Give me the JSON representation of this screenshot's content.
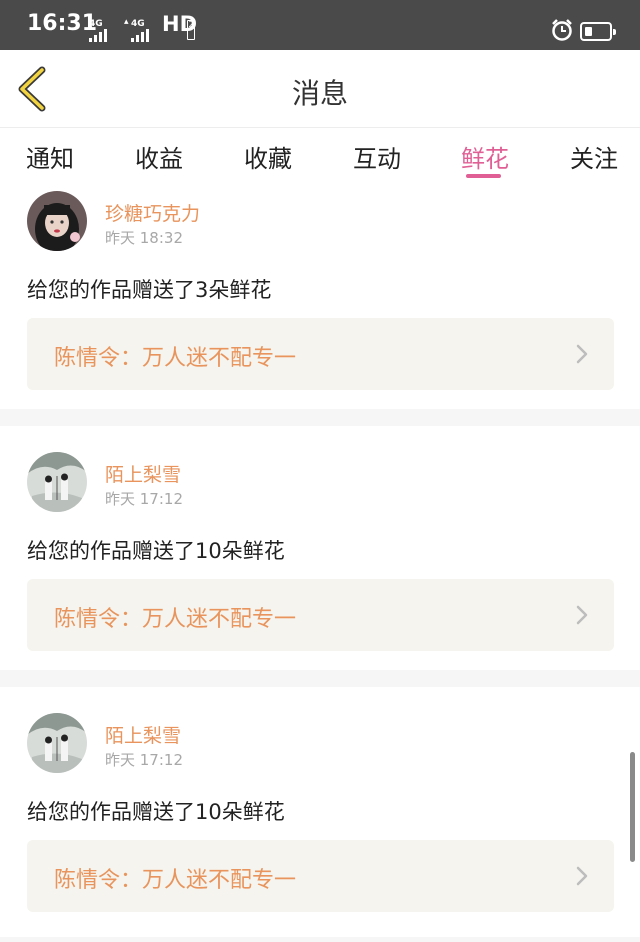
{
  "status_bar": {
    "time": "16:31",
    "network_1": "4G",
    "network_2": "4G",
    "hd_label": "HD",
    "hd_sub": "2"
  },
  "header": {
    "title": "消息"
  },
  "tabs": [
    {
      "label": "通知"
    },
    {
      "label": "收益"
    },
    {
      "label": "收藏"
    },
    {
      "label": "互动"
    },
    {
      "label": "鲜花",
      "active": true
    },
    {
      "label": "关注"
    }
  ],
  "messages": [
    {
      "user": "珍糖巧克力",
      "time": "昨天 18:32",
      "text": "给您的作品赠送了3朵鲜花",
      "work": "陈情令：万人迷不配专一",
      "avatar": "girl-photo"
    },
    {
      "user": "陌上梨雪",
      "time": "昨天 17:12",
      "text": "给您的作品赠送了10朵鲜花",
      "work": "陈情令：万人迷不配专一",
      "avatar": "ink-painting"
    },
    {
      "user": "陌上梨雪",
      "time": "昨天 17:12",
      "text": "给您的作品赠送了10朵鲜花",
      "work": "陈情令：万人迷不配专一",
      "avatar": "ink-painting"
    }
  ],
  "colors": {
    "accent_pink": "#e06096",
    "name_orange": "#e8945c",
    "link_bg": "#f5f4ee"
  },
  "icons": {
    "back": "chevron-left-icon",
    "alarm": "alarm-clock-icon",
    "battery": "battery-icon",
    "chevron": "chevron-right-icon"
  }
}
